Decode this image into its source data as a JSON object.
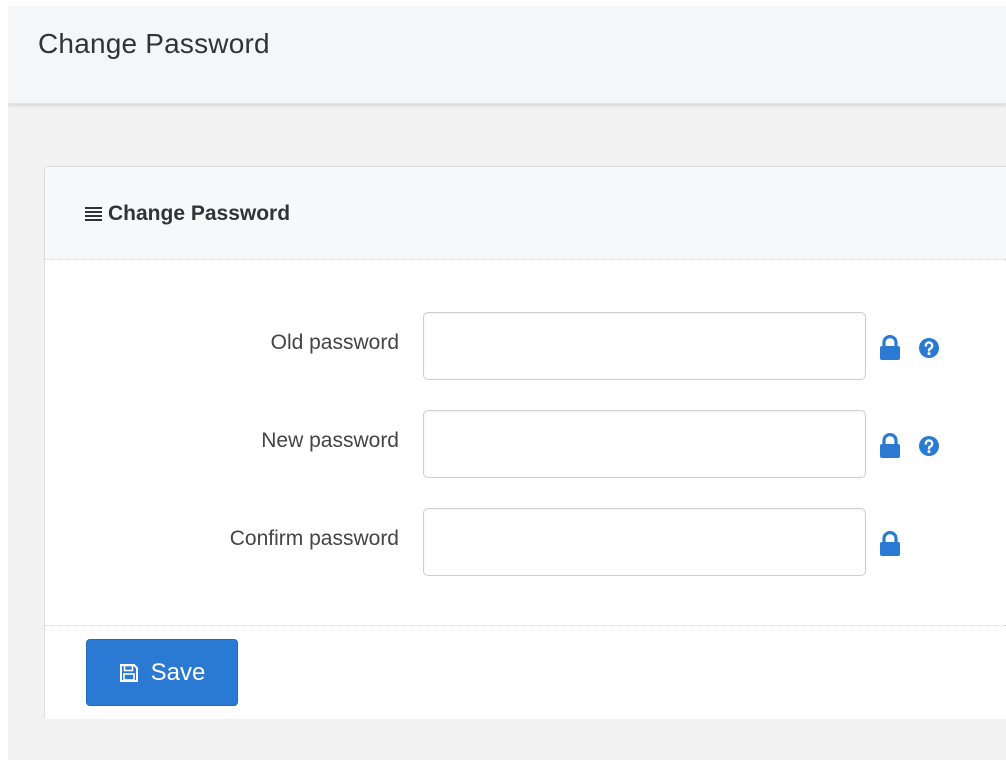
{
  "header": {
    "title": "Change Password"
  },
  "panel": {
    "title": "Change Password",
    "title_icon": "bars-icon"
  },
  "form": {
    "fields": [
      {
        "label": "Old password",
        "value": "",
        "placeholder": "",
        "icons": [
          "lock-icon",
          "question-circle-icon"
        ]
      },
      {
        "label": "New password",
        "value": "",
        "placeholder": "",
        "icons": [
          "lock-icon",
          "question-circle-icon"
        ]
      },
      {
        "label": "Confirm password",
        "value": "",
        "placeholder": "",
        "icons": [
          "lock-icon"
        ]
      }
    ]
  },
  "footer": {
    "save_label": "Save",
    "save_icon": "floppy-disk-icon"
  },
  "colors": {
    "accent": "#2a7ad3",
    "icon_blue": "#2a7ad3",
    "page_background": "#f2f2f2",
    "panel_heading_background": "#f7f8f9"
  }
}
